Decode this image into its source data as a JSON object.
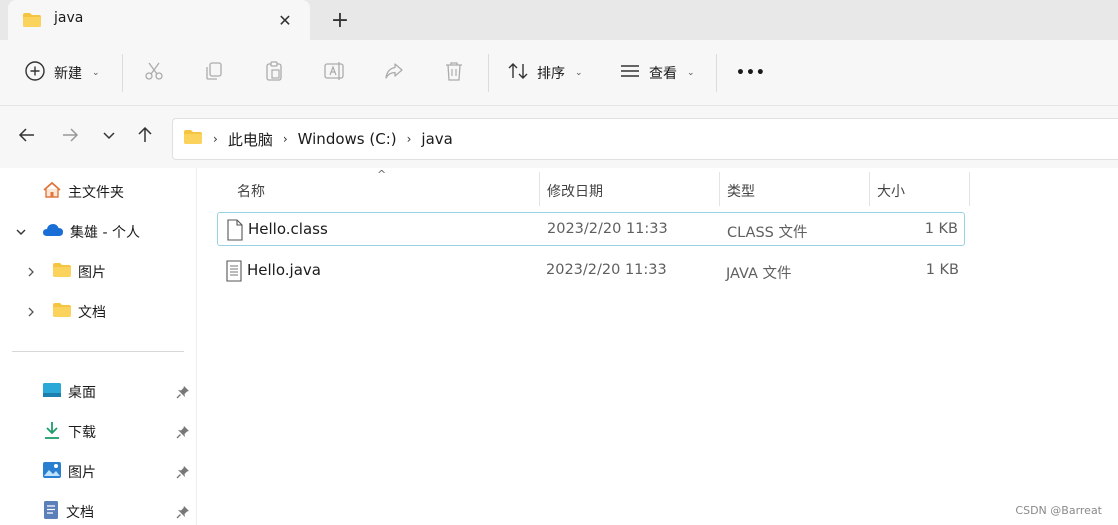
{
  "tab": {
    "title": "java",
    "close_glyph": "✕",
    "new_tab_glyph": "+"
  },
  "toolbar": {
    "new_label": "新建",
    "sort_label": "排序",
    "view_label": "查看",
    "more_glyph": "•••",
    "caret": "⌄"
  },
  "address": {
    "crumbs": [
      "此电脑",
      "Windows (C:)",
      "java"
    ],
    "separator": "›"
  },
  "sidebar": {
    "home": "主文件夹",
    "onedrive": "集雄 - 个人",
    "onedrive_children": [
      "图片",
      "文档"
    ],
    "quick_access": [
      "桌面",
      "下载",
      "图片",
      "文档"
    ]
  },
  "columns": {
    "name": "名称",
    "modified": "修改日期",
    "type": "类型",
    "size": "大小",
    "sort_glyph": "^"
  },
  "files": [
    {
      "name": "Hello.class",
      "modified": "2023/2/20 11:33",
      "type": "CLASS 文件",
      "size": "1 KB",
      "selected": true
    },
    {
      "name": "Hello.java",
      "modified": "2023/2/20 11:33",
      "type": "JAVA 文件",
      "size": "1 KB",
      "selected": false
    }
  ],
  "watermark": "CSDN @Barreat",
  "colors": {
    "folder": "#f5c542",
    "onedrive": "#1a6fd6",
    "selection_border": "#99d1e4",
    "home": "#e0763c"
  }
}
